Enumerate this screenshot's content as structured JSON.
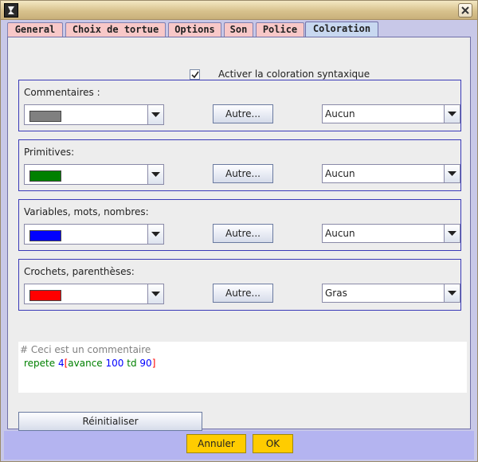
{
  "window": {
    "close_icon": "close-icon",
    "app_icon": "logo-icon"
  },
  "tabs": [
    {
      "label": "General",
      "active": false
    },
    {
      "label": "Choix de tortue",
      "active": false
    },
    {
      "label": "Options",
      "active": false
    },
    {
      "label": "Son",
      "active": false
    },
    {
      "label": "Police",
      "active": false
    },
    {
      "label": "Coloration",
      "active": true
    }
  ],
  "activate": {
    "label": "Activer la coloration syntaxique",
    "checked": true
  },
  "groups": [
    {
      "title": "Commentaires :",
      "color": "#808080",
      "button": "Autre...",
      "style": "Aucun"
    },
    {
      "title": "Primitives:",
      "color": "#008000",
      "button": "Autre...",
      "style": "Aucun"
    },
    {
      "title": "Variables, mots, nombres:",
      "color": "#0000ff",
      "button": "Autre...",
      "style": "Aucun"
    },
    {
      "title": "Crochets, parenthèses:",
      "color": "#ff0000",
      "button": "Autre...",
      "style": "Gras"
    }
  ],
  "preview": {
    "comment": "# Ceci est un commentaire",
    "code": {
      "primitive1": "repete",
      "number1": "4",
      "bracket_open": "[",
      "primitive2": "avance",
      "number2": "100",
      "primitive3": "td",
      "number3": "90",
      "bracket_close": "]"
    }
  },
  "reset_button": "Réinitialiser",
  "footer": {
    "cancel": "Annuler",
    "ok": "OK"
  }
}
